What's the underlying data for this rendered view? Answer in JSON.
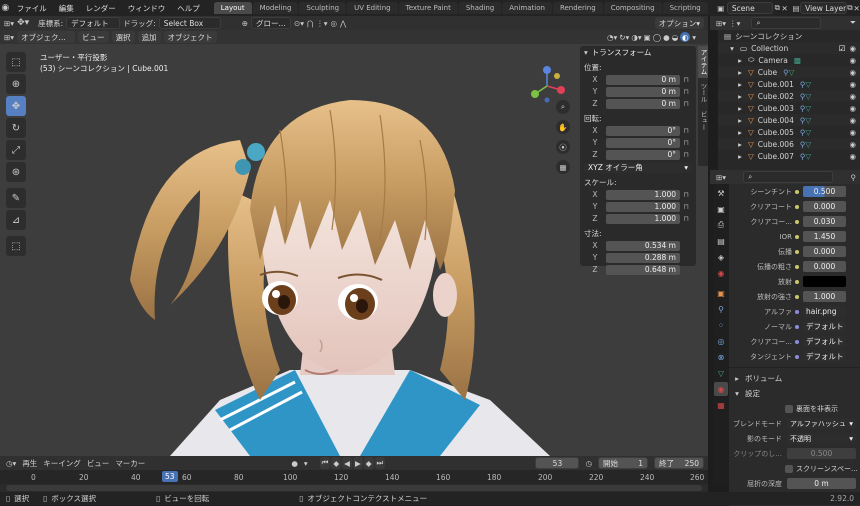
{
  "topbar": {
    "menus": [
      "ファイル",
      "編集",
      "レンダー",
      "ウィンドウ",
      "ヘルプ"
    ],
    "workspaces": [
      "Layout",
      "Modeling",
      "Sculpting",
      "UV Editing",
      "Texture Paint",
      "Shading",
      "Animation",
      "Rendering",
      "Compositing",
      "Scripting"
    ],
    "active_workspace": "Layout",
    "scene": "Scene",
    "view_layer": "View Layer"
  },
  "toolheader": {
    "orientation_label": "座標系:",
    "orientation_value": "デフォルト",
    "drag_label": "ドラッグ:",
    "drag_value": "Select Box",
    "pivot_value": "グロー...",
    "options_label": "オプション"
  },
  "viewport_header": {
    "mode": "オブジェク...",
    "menus": [
      "ビュー",
      "選択",
      "追加",
      "オブジェクト"
    ]
  },
  "viewport": {
    "view_name": "ユーザー・平行投影",
    "collection_info": "(53) シーンコレクション | Cube.001",
    "side_tabs": [
      "アイテム",
      "ツール",
      "ビュー"
    ]
  },
  "npanel": {
    "title": "トランスフォーム",
    "location_label": "位置:",
    "location": [
      {
        "axis": "X",
        "value": "0 m"
      },
      {
        "axis": "Y",
        "value": "0 m"
      },
      {
        "axis": "Z",
        "value": "0 m"
      }
    ],
    "rotation_label": "回転:",
    "rotation": [
      {
        "axis": "X",
        "value": "0°"
      },
      {
        "axis": "Y",
        "value": "0°"
      },
      {
        "axis": "Z",
        "value": "0°"
      }
    ],
    "rotation_mode": "XYZ オイラー角",
    "scale_label": "スケール:",
    "scale": [
      {
        "axis": "X",
        "value": "1.000"
      },
      {
        "axis": "Y",
        "value": "1.000"
      },
      {
        "axis": "Z",
        "value": "1.000"
      }
    ],
    "dimensions_label": "寸法:",
    "dimensions": [
      {
        "axis": "X",
        "value": "0.534 m"
      },
      {
        "axis": "Y",
        "value": "0.288 m"
      },
      {
        "axis": "Z",
        "value": "0.648 m"
      }
    ]
  },
  "outliner": {
    "root": "シーンコレクション",
    "collection": "Collection",
    "items": [
      "Camera",
      "Cube",
      "Cube.001",
      "Cube.002",
      "Cube.003",
      "Cube.004",
      "Cube.005",
      "Cube.006",
      "Cube.007"
    ]
  },
  "properties": {
    "rows": [
      {
        "label": "シーンチント",
        "value": "0.500",
        "kind": "slider"
      },
      {
        "label": "クリアコート",
        "value": "0.000",
        "kind": "num"
      },
      {
        "label": "クリアコー...",
        "value": "0.030",
        "kind": "num"
      },
      {
        "label": "IOR",
        "value": "1.450",
        "kind": "num"
      },
      {
        "label": "伝播",
        "value": "0.000",
        "kind": "num"
      },
      {
        "label": "伝播の粗さ",
        "value": "0.000",
        "kind": "num"
      },
      {
        "label": "放射",
        "value": "",
        "kind": "color"
      },
      {
        "label": "放射の強さ",
        "value": "1.000",
        "kind": "num"
      },
      {
        "label": "アルファ",
        "value": "hair.png",
        "kind": "link"
      },
      {
        "label": "ノーマル",
        "value": "デフォルト",
        "kind": "link"
      },
      {
        "label": "クリアコー...",
        "value": "デフォルト",
        "kind": "link"
      },
      {
        "label": "タンジェント",
        "value": "デフォルト",
        "kind": "link"
      }
    ],
    "volume_panel": "ボリューム",
    "settings_panel": "設定",
    "backface_label": "裏面を非表示",
    "blend_label": "ブレンドモード",
    "blend_value": "アルファハッシュ",
    "shadow_label": "影のモード",
    "shadow_value": "不透明",
    "clip_label": "クリップのし...",
    "clip_value": "0.500",
    "screen_space_label": "スクリーンスペー...",
    "refraction_label": "屈折の深度",
    "refraction_value": "0 m"
  },
  "timeline": {
    "menus": [
      "再生",
      "キーイング",
      "ビュー",
      "マーカー"
    ],
    "current_frame": "53",
    "start_label": "開始",
    "start": "1",
    "end_label": "終了",
    "end": "250",
    "ticks": [
      "0",
      "20",
      "40",
      "53",
      "60",
      "80",
      "100",
      "120",
      "140",
      "160",
      "180",
      "200",
      "220",
      "240",
      "260"
    ]
  },
  "statusbar": {
    "select": "選択",
    "box_select": "ボックス選択",
    "rotate_view": "ビューを回転",
    "context_menu": "オブジェクトコンテクストメニュー",
    "version": "2.92.0"
  },
  "colors": {
    "accent": "#4772b3",
    "active_tool": "#5680c2",
    "background": "#3d3d3d"
  }
}
